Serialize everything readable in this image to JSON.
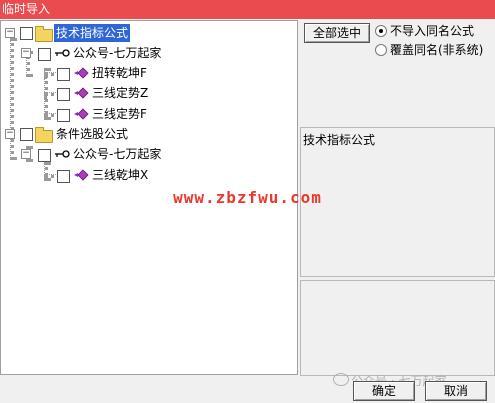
{
  "window": {
    "title": "临时导入"
  },
  "tree": {
    "nodes": [
      {
        "label": "技术指标公式"
      },
      {
        "label": "公众号-七万起家"
      },
      {
        "label": "扭转乾坤F"
      },
      {
        "label": "三线定势Z"
      },
      {
        "label": "三线定势F"
      },
      {
        "label": "条件选股公式"
      },
      {
        "label": "公众号-七万起家"
      },
      {
        "label": "三线乾坤X"
      }
    ]
  },
  "side": {
    "select_all_label": "全部选中",
    "option_skip_label": "不导入同名公式",
    "option_overwrite_label": "覆盖同名(非系统)",
    "selected_option": "不导入同名公式",
    "info_title": "技术指标公式"
  },
  "footer": {
    "ok_label": "确定",
    "cancel_label": "取消"
  },
  "watermarks": {
    "site": "www.zbzfwu.com",
    "account": "公众号 · 七万起家"
  }
}
